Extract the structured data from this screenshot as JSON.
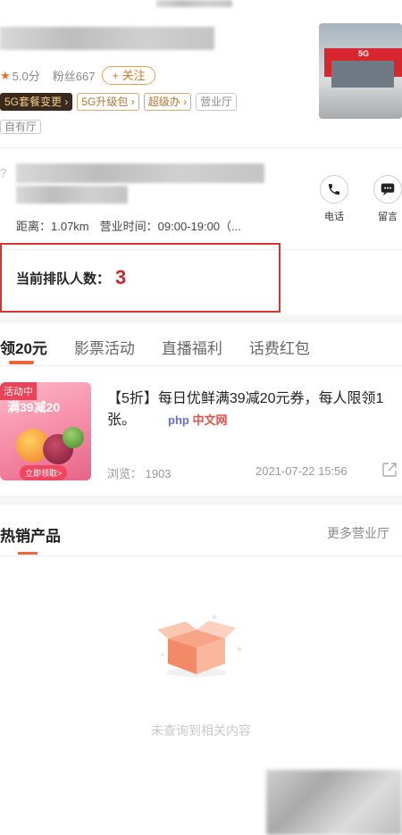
{
  "store": {
    "rating": "5.0分",
    "fans": "粉丝667",
    "follow_label": "关注",
    "tags": [
      "5G套餐变更",
      "5G升级包",
      "超级办",
      "营业厅"
    ],
    "type_tag": "自有厅",
    "photo_logo": "5G"
  },
  "address": {
    "distance_label": "距离：1.07km",
    "hours_label": "营业时间：09:00-19:00（..."
  },
  "actions": {
    "phone_label": "电话",
    "message_label": "留言"
  },
  "queue": {
    "label": "当前排队人数：",
    "count": "3"
  },
  "tabs": [
    "领20元",
    "影票活动",
    "直播福利",
    "话费红包"
  ],
  "promo": {
    "badge": "活动中",
    "thumb_headline": "满39减20",
    "thumb_cta": "立即领取>",
    "title": "【5折】每日优鲜满39减20元券，每人限领1张。",
    "views": "浏览：  1903",
    "date": "2021-07-22 15:56"
  },
  "watermark": {
    "php": "php",
    "cn": "中文网"
  },
  "hot": {
    "title": "热销产品",
    "more": "更多营业厅",
    "empty_text": "未查询到相关内容"
  },
  "colors": {
    "accent": "#f0643c",
    "queue_border": "#d9322f",
    "queue_number": "#c9252a",
    "rating_star": "#f36b1c"
  }
}
